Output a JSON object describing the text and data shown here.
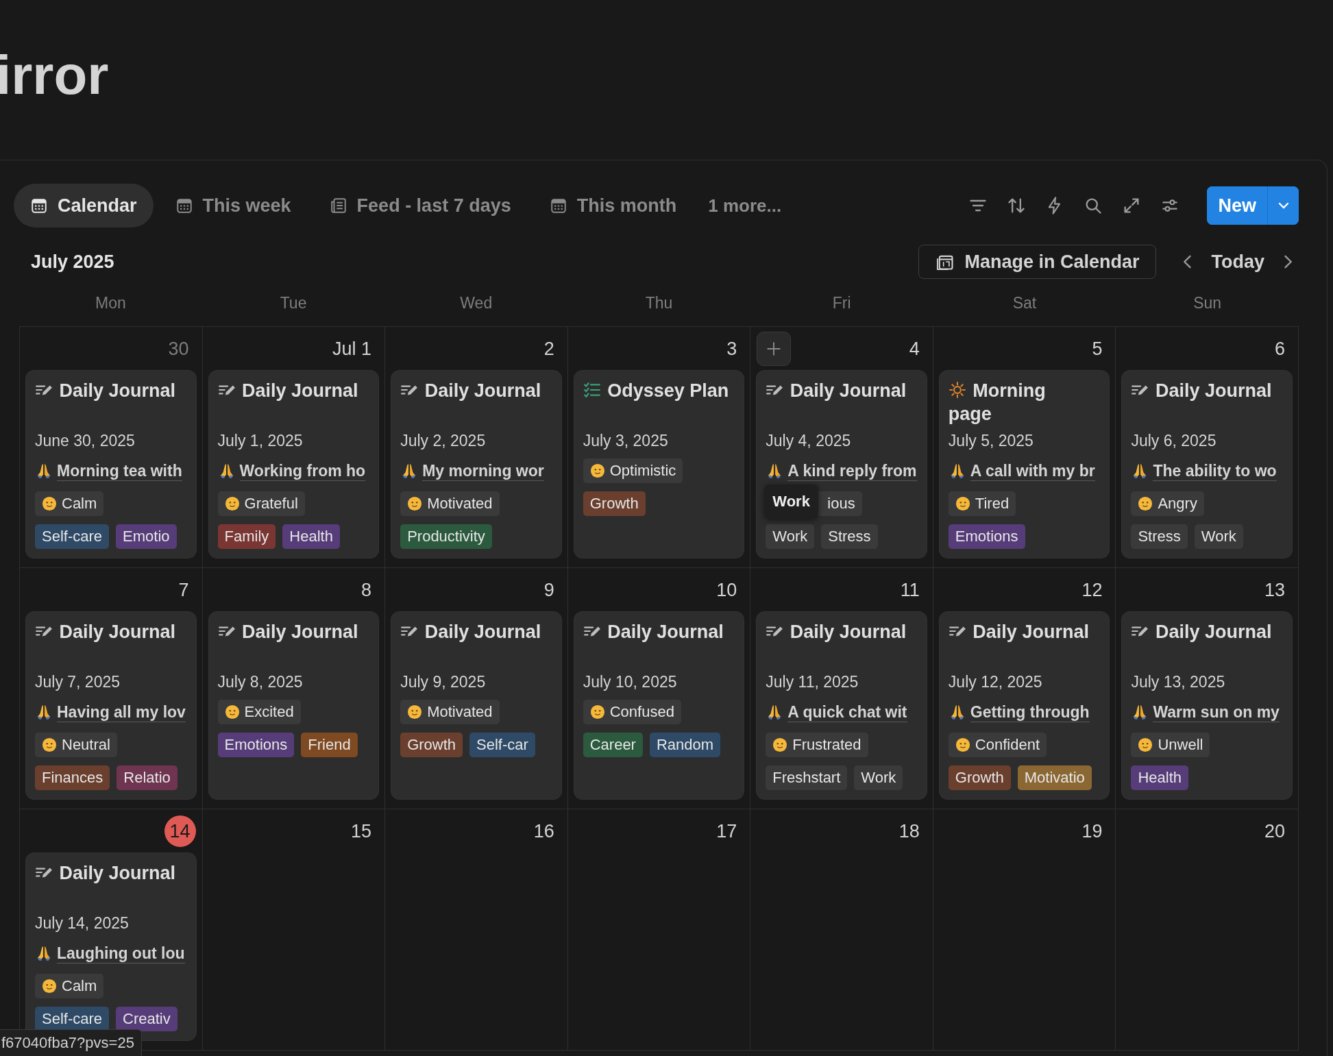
{
  "page_title": "irror",
  "views": {
    "tabs": [
      {
        "label": "Calendar",
        "kind": "calendar",
        "selected": true
      },
      {
        "label": "This week",
        "kind": "calendar",
        "selected": false
      },
      {
        "label": "Feed - last 7 days",
        "kind": "feed",
        "selected": false
      },
      {
        "label": "This month",
        "kind": "calendar",
        "selected": false
      }
    ],
    "more": "1 more..."
  },
  "toolbar": {
    "new_button": "New"
  },
  "calendar": {
    "month": "July 2025",
    "manage_button": "Manage in Calendar",
    "today_button": "Today",
    "weekdays": [
      "Mon",
      "Tue",
      "Wed",
      "Thu",
      "Fri",
      "Sat",
      "Sun"
    ],
    "weeks": [
      {
        "days": [
          {
            "day": "30",
            "muted": true,
            "today": false,
            "cards": [
              {
                "kind": "journal",
                "title": "Daily Journal",
                "date": "June 30, 2025",
                "gratitude": "Morning tea with",
                "mood": "Calm",
                "tags": [
                  {
                    "label": "Self-care",
                    "color": "#2e4a66"
                  },
                  {
                    "label": "Emotio",
                    "color": "#563c78"
                  }
                ]
              }
            ]
          },
          {
            "day": "Jul 1",
            "muted": false,
            "today": false,
            "cards": [
              {
                "kind": "journal",
                "title": "Daily Journal",
                "date": "July 1, 2025",
                "gratitude": "Working from ho",
                "mood": "Grateful",
                "tags": [
                  {
                    "label": "Family",
                    "color": "#7a3632"
                  },
                  {
                    "label": "Health",
                    "color": "#563c78"
                  }
                ]
              }
            ]
          },
          {
            "day": "2",
            "muted": false,
            "today": false,
            "cards": [
              {
                "kind": "journal",
                "title": "Daily Journal",
                "date": "July 2, 2025",
                "gratitude": "My morning wor",
                "mood": "Motivated",
                "tags": [
                  {
                    "label": "Productivity",
                    "color": "#2b5a3e"
                  }
                ]
              }
            ]
          },
          {
            "day": "3",
            "muted": false,
            "today": false,
            "cards": [
              {
                "kind": "plan",
                "title": "Odyssey Plan",
                "date": "July 3, 2025",
                "mood": "Optimistic",
                "tags": [
                  {
                    "label": "Growth",
                    "color": "#6a3f2e"
                  }
                ]
              }
            ]
          },
          {
            "day": "4",
            "muted": false,
            "today": false,
            "add_button": true,
            "cards": [
              {
                "kind": "journal",
                "title": "Daily Journal",
                "date": "July 4, 2025",
                "gratitude": "A kind reply from",
                "mood": "ious",
                "tooltip": "Work",
                "tags": [
                  {
                    "label": "Work",
                    "color": "#3a3a3a"
                  },
                  {
                    "label": "Stress",
                    "color": "#3a3a3a"
                  }
                ]
              }
            ]
          },
          {
            "day": "5",
            "muted": false,
            "today": false,
            "cards": [
              {
                "kind": "morning",
                "title": "Morning page",
                "date": "July 5, 2025",
                "gratitude": "A call with my br",
                "mood": "Tired",
                "tags": [
                  {
                    "label": "Emotions",
                    "color": "#563c78"
                  }
                ]
              }
            ]
          },
          {
            "day": "6",
            "muted": false,
            "today": false,
            "cards": [
              {
                "kind": "journal",
                "title": "Daily Journal",
                "date": "July 6, 2025",
                "gratitude": "The ability to wo",
                "mood": "Angry",
                "tags": [
                  {
                    "label": "Stress",
                    "color": "#3a3a3a"
                  },
                  {
                    "label": "Work",
                    "color": "#3a3a3a"
                  }
                ]
              }
            ]
          }
        ]
      },
      {
        "days": [
          {
            "day": "7",
            "muted": false,
            "today": false,
            "cards": [
              {
                "kind": "journal",
                "title": "Daily Journal",
                "date": "July 7, 2025",
                "gratitude": "Having all my lov",
                "mood": "Neutral",
                "tags": [
                  {
                    "label": "Finances",
                    "color": "#6a3f2e"
                  },
                  {
                    "label": "Relatio",
                    "color": "#6e3450"
                  }
                ]
              }
            ]
          },
          {
            "day": "8",
            "muted": false,
            "today": false,
            "cards": [
              {
                "kind": "journal",
                "title": "Daily Journal",
                "date": "July 8, 2025",
                "mood": "Excited",
                "tags": [
                  {
                    "label": "Emotions",
                    "color": "#563c78"
                  },
                  {
                    "label": "Friend",
                    "color": "#7f4a22"
                  }
                ]
              }
            ]
          },
          {
            "day": "9",
            "muted": false,
            "today": false,
            "cards": [
              {
                "kind": "journal",
                "title": "Daily Journal",
                "date": "July 9, 2025",
                "mood": "Motivated",
                "tags": [
                  {
                    "label": "Growth",
                    "color": "#6a3f2e"
                  },
                  {
                    "label": "Self-car",
                    "color": "#2e4a66"
                  }
                ]
              }
            ]
          },
          {
            "day": "10",
            "muted": false,
            "today": false,
            "cards": [
              {
                "kind": "journal",
                "title": "Daily Journal",
                "date": "July 10, 2025",
                "mood": "Confused",
                "tags": [
                  {
                    "label": "Career",
                    "color": "#2b5a3e"
                  },
                  {
                    "label": "Random",
                    "color": "#2e4a66"
                  }
                ]
              }
            ]
          },
          {
            "day": "11",
            "muted": false,
            "today": false,
            "cards": [
              {
                "kind": "journal",
                "title": "Daily Journal",
                "date": "July 11, 2025",
                "gratitude": "A quick chat wit",
                "mood": "Frustrated",
                "tags": [
                  {
                    "label": "Freshstart",
                    "color": "#3a3a3a"
                  },
                  {
                    "label": "Work",
                    "color": "#3a3a3a"
                  }
                ]
              }
            ]
          },
          {
            "day": "12",
            "muted": false,
            "today": false,
            "cards": [
              {
                "kind": "journal",
                "title": "Daily Journal",
                "date": "July 12, 2025",
                "gratitude": "Getting through",
                "mood": "Confident",
                "tags": [
                  {
                    "label": "Growth",
                    "color": "#6a3f2e"
                  },
                  {
                    "label": "Motivatio",
                    "color": "#8b6833"
                  }
                ]
              }
            ]
          },
          {
            "day": "13",
            "muted": false,
            "today": false,
            "cards": [
              {
                "kind": "journal",
                "title": "Daily Journal",
                "date": "July 13, 2025",
                "gratitude": "Warm sun on my",
                "mood": "Unwell",
                "tags": [
                  {
                    "label": "Health",
                    "color": "#563c78"
                  }
                ]
              }
            ]
          }
        ]
      },
      {
        "days": [
          {
            "day": "14",
            "muted": false,
            "today": true,
            "cards": [
              {
                "kind": "journal",
                "title": "Daily Journal",
                "date": "July 14, 2025",
                "gratitude": "Laughing out lou",
                "mood": "Calm",
                "tags": [
                  {
                    "label": "Self-care",
                    "color": "#2e4a66"
                  },
                  {
                    "label": "Creativ",
                    "color": "#563c78"
                  }
                ]
              }
            ]
          },
          {
            "day": "15",
            "muted": false,
            "today": false
          },
          {
            "day": "16",
            "muted": false,
            "today": false
          },
          {
            "day": "17",
            "muted": false,
            "today": false
          },
          {
            "day": "18",
            "muted": false,
            "today": false
          },
          {
            "day": "19",
            "muted": false,
            "today": false
          },
          {
            "day": "20",
            "muted": false,
            "today": false
          }
        ]
      }
    ]
  },
  "status_url": "f67040fba7?pvs=25"
}
